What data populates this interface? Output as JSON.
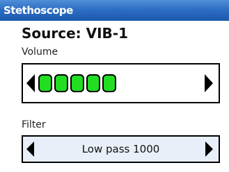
{
  "window": {
    "title": "Stethoscope"
  },
  "source": {
    "text": "Source: VIB-1"
  },
  "volume": {
    "label": "Volume",
    "level_segments": 5,
    "bar_color": "#22dd22"
  },
  "filter": {
    "label": "Filter",
    "value": "Low pass 1000"
  },
  "colors": {
    "titlebar": "#2d6fc4",
    "filter_background": "#e8eff8"
  }
}
